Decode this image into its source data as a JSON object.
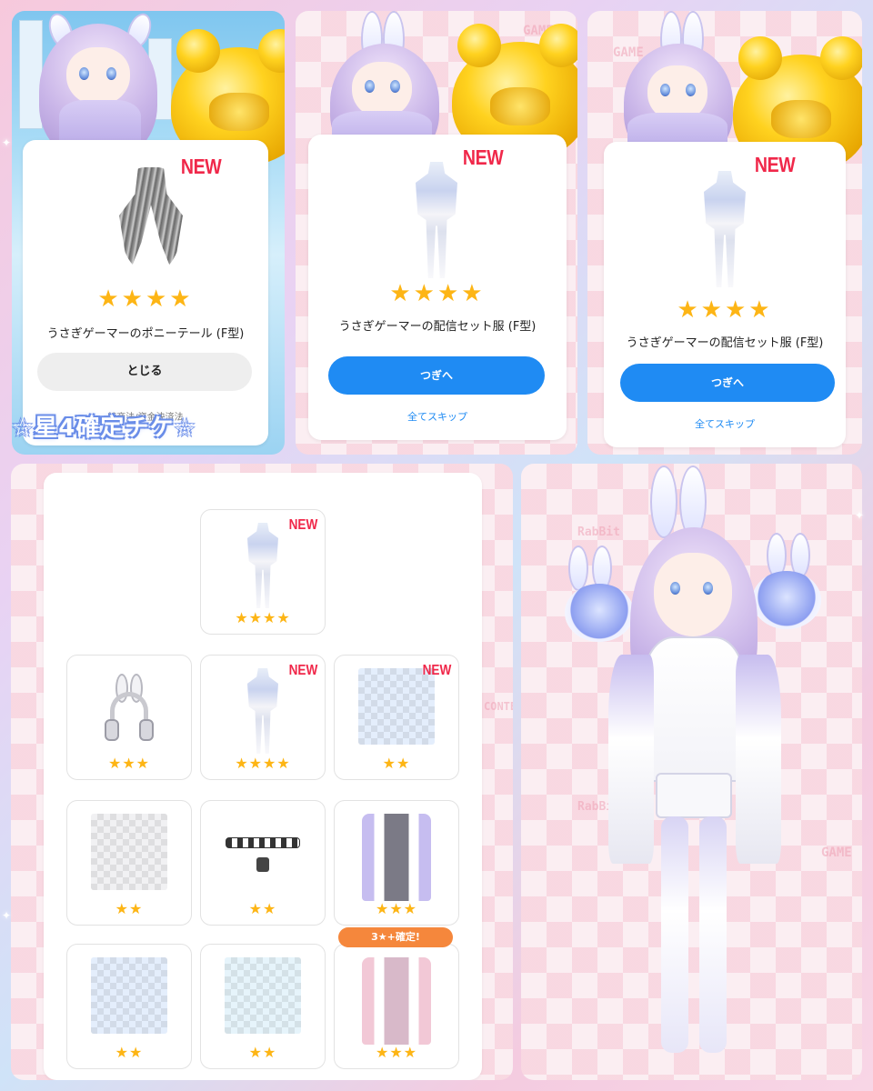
{
  "panel1": {
    "new_label": "NEW",
    "stars": "★★★★",
    "item_name": "うさぎゲーマーのポニーテール (F型)",
    "close_button": "とじる",
    "legal_text": "特商法/資金決済法",
    "caption": "☆星4確定チケ☆"
  },
  "panel2": {
    "new_label": "NEW",
    "stars": "★★★★",
    "item_name": "うさぎゲーマーの配信セット服 (F型)",
    "next_button": "つぎへ",
    "skip_link": "全てスキップ"
  },
  "panel3": {
    "new_label": "NEW",
    "stars": "★★★★",
    "item_name": "うさぎゲーマーの配信セット服 (F型)",
    "next_button": "つぎへ",
    "skip_link": "全てスキップ"
  },
  "gallery": {
    "items": [
      {
        "kind": "outfit",
        "stars": "★★★★",
        "new": "NEW"
      },
      {
        "kind": "headphones",
        "stars": "★★★",
        "new": ""
      },
      {
        "kind": "outfit",
        "stars": "★★★★",
        "new": "NEW"
      },
      {
        "kind": "pattern-blue",
        "stars": "★★",
        "new": "NEW"
      },
      {
        "kind": "pattern-grey",
        "stars": "★★",
        "new": ""
      },
      {
        "kind": "choker",
        "stars": "★★",
        "new": ""
      },
      {
        "kind": "jacket-purple",
        "stars": "★★★",
        "new": ""
      },
      {
        "kind": "pattern-blue",
        "stars": "★★",
        "new": ""
      },
      {
        "kind": "pattern-cyan",
        "stars": "★★",
        "new": ""
      },
      {
        "kind": "jacket-pink",
        "stars": "★★★",
        "new": ""
      }
    ],
    "confirm_tag": "3★+確定!"
  },
  "background_words": {
    "rabbit": "RabBit",
    "game": "GAME",
    "content": "CONTENT"
  },
  "colors": {
    "accent_blue": "#1f8bf3",
    "new_red": "#f0284a",
    "star_gold": "#fdb515",
    "confirm_orange": "#f5873c"
  }
}
